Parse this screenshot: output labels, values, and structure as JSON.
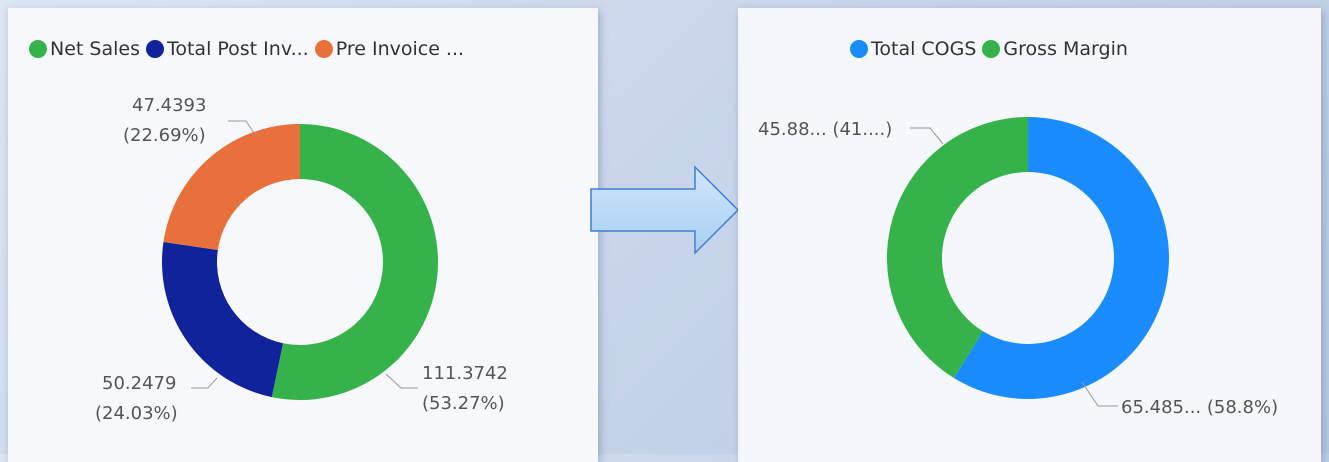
{
  "chart_data": [
    {
      "type": "donut",
      "legend": {
        "position": "top-left"
      },
      "series": [
        {
          "name": "Net Sales",
          "legend_label": "Net Sales",
          "value": 111.3742,
          "percent": 53.27,
          "color": "#36b24a",
          "label_value": "111.3742",
          "label_pct": "(53.27%)"
        },
        {
          "name": "Total Post Invoice Deductions",
          "legend_label": "Total Post Inv...",
          "value": 50.2479,
          "percent": 24.03,
          "color": "#11239a",
          "label_value": "50.2479",
          "label_pct": "(24.03%)"
        },
        {
          "name": "Pre Invoice Deductions",
          "legend_label": "Pre Invoice ...",
          "value": 47.4393,
          "percent": 22.69,
          "color": "#e8703a",
          "label_value": "47.4393",
          "label_pct": "(22.69%)"
        }
      ]
    },
    {
      "type": "donut",
      "legend": {
        "position": "top-center"
      },
      "series": [
        {
          "name": "Total COGS",
          "legend_label": "Total COGS",
          "value": 65.485,
          "percent": 58.8,
          "color": "#1a8cff",
          "label_text": "65.485... (58.8%)"
        },
        {
          "name": "Gross Margin",
          "legend_label": "Gross Margin",
          "value": 45.88,
          "percent": 41.2,
          "color": "#36b24a",
          "label_text": "45.88... (41....)"
        }
      ]
    }
  ]
}
